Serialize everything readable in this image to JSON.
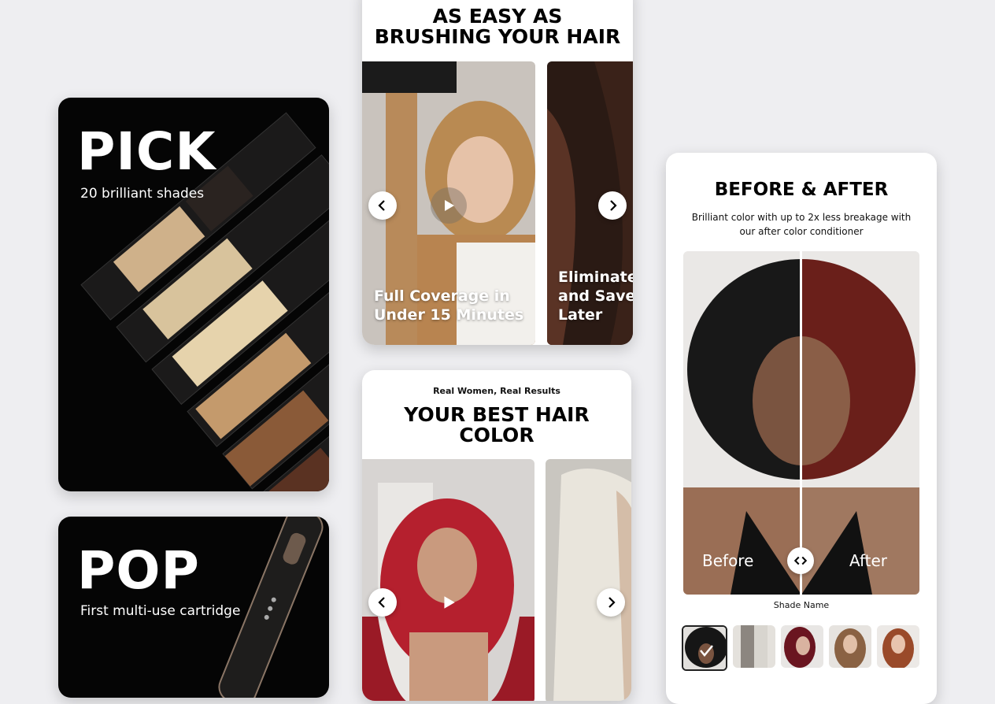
{
  "pick_card": {
    "title": "PICK",
    "subtitle": "20 brilliant shades"
  },
  "pop_card": {
    "title": "POP",
    "subtitle": "First multi-use cartridge"
  },
  "easy_card": {
    "heading_line1": "AS EASY AS",
    "heading_line2": "BRUSHING YOUR HAIR",
    "slides": [
      {
        "caption_line1": "Full Coverage in",
        "caption_line2": "Under 15 Minutes"
      },
      {
        "caption_line1": "Eliminate",
        "caption_line2": "and Save",
        "caption_line3": "Later"
      }
    ]
  },
  "results_card": {
    "kicker": "Real Women, Real Results",
    "heading_line1": "YOUR BEST HAIR",
    "heading_line2": "COLOR"
  },
  "before_after_card": {
    "heading": "BEFORE & AFTER",
    "subtitle_line1": "Brilliant color with up to 2x less breakage with",
    "subtitle_line2": "our after color conditioner",
    "before_label": "Before",
    "after_label": "After",
    "shade_label": "Shade Name",
    "shades": [
      "shade-1",
      "shade-2",
      "shade-3",
      "shade-4",
      "shade-5"
    ]
  }
}
